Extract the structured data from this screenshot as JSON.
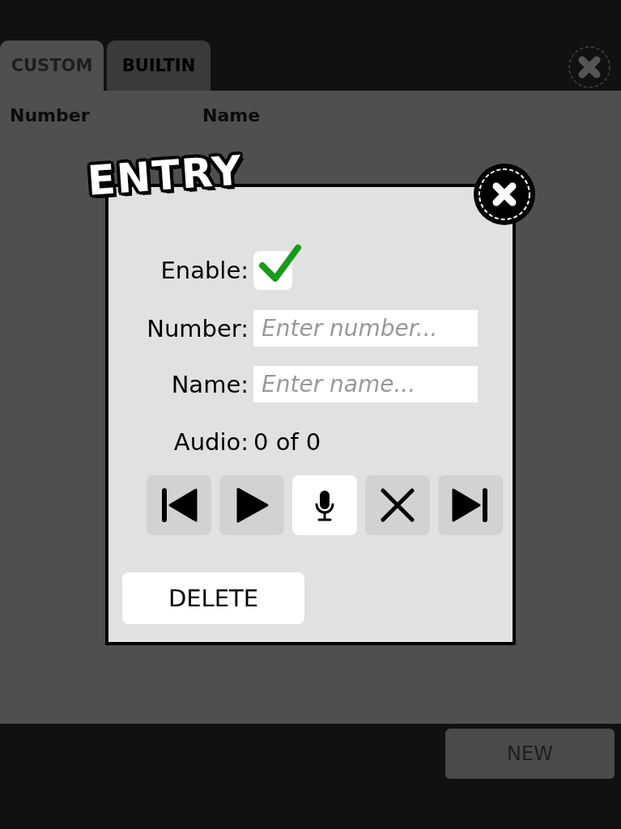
{
  "tabs": [
    {
      "label": "CUSTOM",
      "selected": true
    },
    {
      "label": "BUILTIN",
      "selected": false
    }
  ],
  "columns": [
    "Number",
    "Name"
  ],
  "dialog": {
    "title": "ENTRY",
    "enable": {
      "label": "Enable:",
      "checked": true
    },
    "number": {
      "label": "Number:",
      "placeholder": "Enter number..."
    },
    "name": {
      "label": "Name:",
      "placeholder": "Enter name..."
    },
    "audio": {
      "label": "Audio:",
      "value": "0 of 0"
    },
    "controls": [
      {
        "kind": "previous",
        "selected": false
      },
      {
        "kind": "play",
        "selected": false
      },
      {
        "kind": "record",
        "selected": true
      },
      {
        "kind": "remove",
        "selected": false
      },
      {
        "kind": "next",
        "selected": false
      }
    ],
    "delete_button": "DELETE"
  },
  "new_button": "NEW"
}
